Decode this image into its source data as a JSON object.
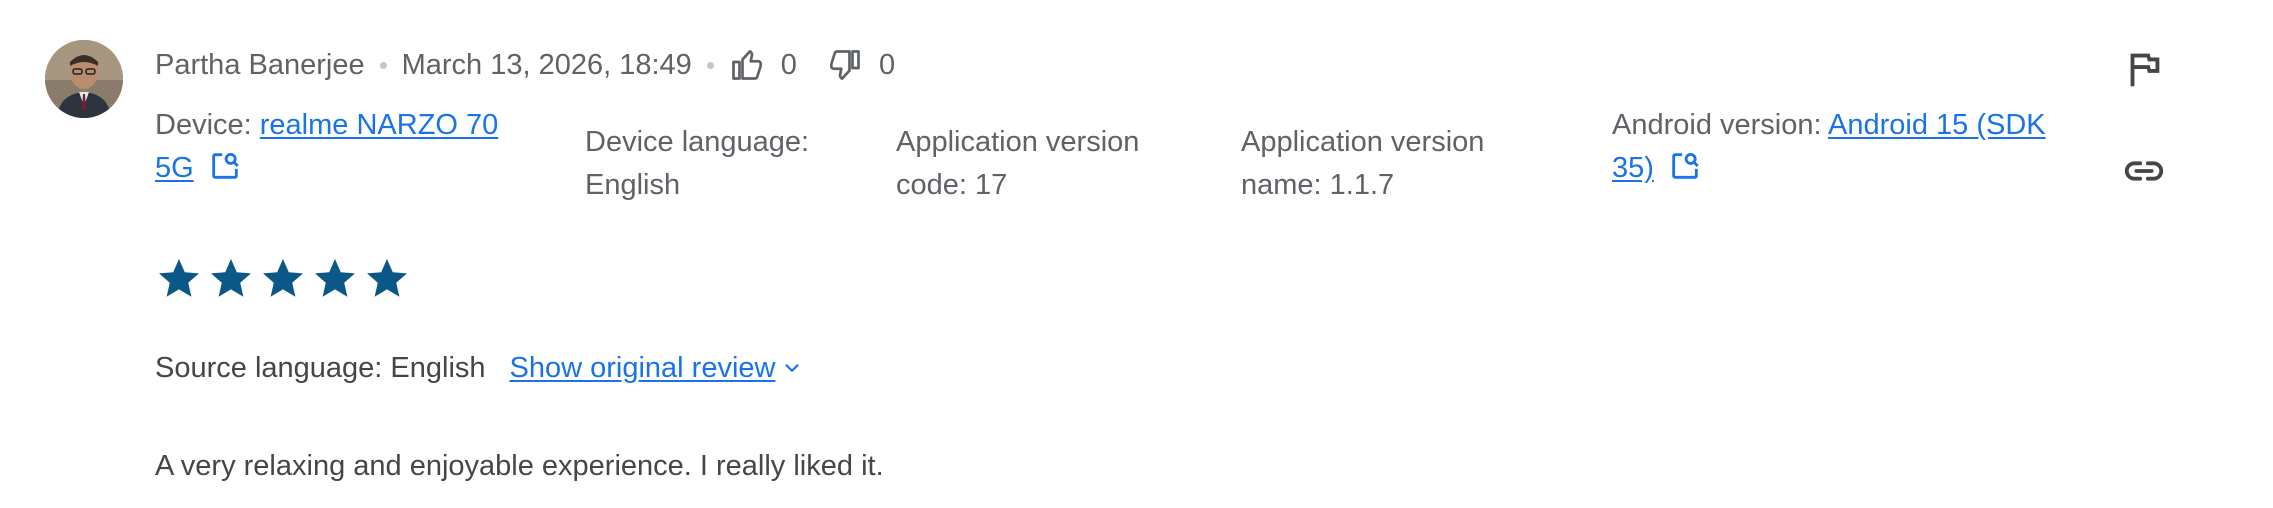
{
  "review": {
    "author": "Partha Banerjee",
    "date": "March 13, 2026, 18:49",
    "thumbs_up_count": "0",
    "thumbs_down_count": "0",
    "device_label": "Device: ",
    "device_value": "realme NARZO 70 5G",
    "device_language_label": "Device language:",
    "device_language_value": "English",
    "app_version_code_label": "Application version code: 17",
    "app_version_name_label": "Application version name: 1.1.7",
    "android_version_label": "Android version: ",
    "android_version_value": "Android 15 (SDK 35)",
    "rating": 5,
    "source_language": "Source language: English",
    "show_original": "Show original review",
    "text": "A very relaxing and enjoyable experience. I really liked it."
  },
  "icons": {
    "thumbs_up": "thumb-up-icon",
    "thumbs_down": "thumb-down-icon",
    "flag": "flag-icon",
    "link": "link-icon",
    "external": "open-in-new-icon",
    "star": "star-icon",
    "chevron": "chevron-down-icon"
  },
  "colors": {
    "link": "#1a73e8",
    "star": "#0b5788",
    "muted_text": "#5f6368"
  }
}
